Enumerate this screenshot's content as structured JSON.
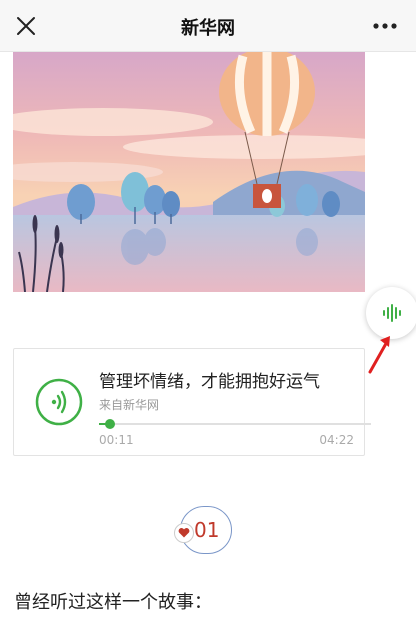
{
  "navbar": {
    "title": "新华网",
    "close_icon": "close-icon",
    "more_icon": "more-icon"
  },
  "hero": {
    "description_icon": "hot-air-balloon-illustration"
  },
  "floating_audio_button": {
    "icon": "audio-wave-icon",
    "accent": "#3fb046"
  },
  "audio_card": {
    "title": "管理坏情绪，才能拥抱好运气",
    "source": "来自新华网",
    "current_time": "00:11",
    "total_time": "04:22",
    "progress": 0.042,
    "accent": "#3fb046"
  },
  "section_badge": {
    "number": "01",
    "icon": "heart-icon"
  },
  "article": {
    "first_line": "曾经听过这样一个故事："
  }
}
